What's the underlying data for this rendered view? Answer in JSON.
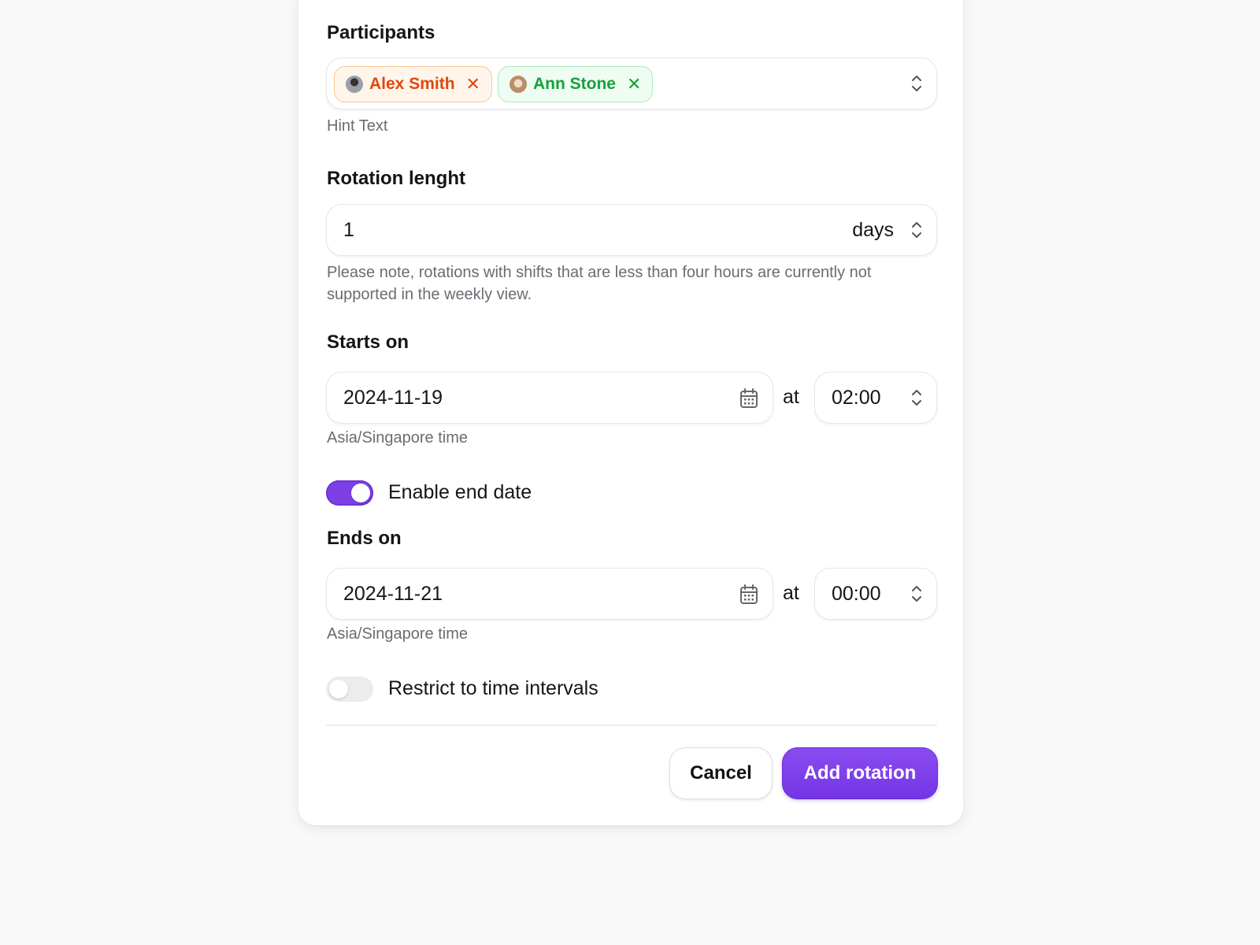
{
  "participants": {
    "label": "Participants",
    "hint": "Hint Text",
    "selected": [
      {
        "name": "Alex Smith",
        "color": "#e0480f",
        "remove_icon": "close-icon"
      },
      {
        "name": "Ann Stone",
        "color": "#17a03b",
        "remove_icon": "close-icon"
      }
    ]
  },
  "rotation_length": {
    "label": "Rotation lenght",
    "value": "1",
    "unit": "days",
    "note": "Please note, rotations with shifts that are less than four hours are currently not supported in the weekly view."
  },
  "starts_on": {
    "label": "Starts on",
    "date": "2024-11-19",
    "at_label": "at",
    "time": "02:00",
    "timezone": "Asia/Singapore time"
  },
  "enable_end_date": {
    "label": "Enable end date",
    "on": true
  },
  "ends_on": {
    "label": "Ends on",
    "date": "2024-11-21",
    "at_label": "at",
    "time": "00:00",
    "timezone": "Asia/Singapore time"
  },
  "restrict_intervals": {
    "label": "Restrict to time intervals",
    "on": false
  },
  "actions": {
    "cancel_label": "Cancel",
    "submit_label": "Add rotation",
    "accent_color": "#7b3fe4"
  }
}
